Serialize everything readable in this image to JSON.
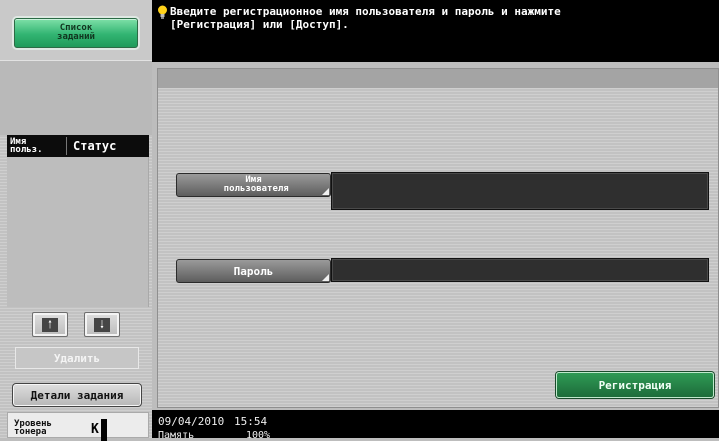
{
  "left_panel": {
    "job_list_button": "Список\nзаданий",
    "columns": {
      "user": "Имя\nпольз.",
      "status": "Статус"
    },
    "delete_button": "Удалить",
    "job_details_button": "Детали задания",
    "toner": {
      "label": "Уровень\nтонера",
      "color": "K"
    }
  },
  "message": {
    "text": "Введите регистрационное имя пользователя и пароль и нажмите\n[Регистрация] или [Доступ].",
    "icon": "lightbulb-icon"
  },
  "form": {
    "username_button": "Имя\n пользователя",
    "password_button": "Пароль",
    "username_value": "",
    "password_value": "",
    "login_button": "Регистрация"
  },
  "status_bar": {
    "date": "09/04/2010",
    "time": "15:54",
    "memory_label": "Память",
    "memory_value": "100%"
  },
  "colors": {
    "accent_green": "#1d6c3a",
    "job_list_green": "#32b472",
    "panel_gray": "#c2c2c2",
    "field_dark": "#2f2f2f"
  }
}
